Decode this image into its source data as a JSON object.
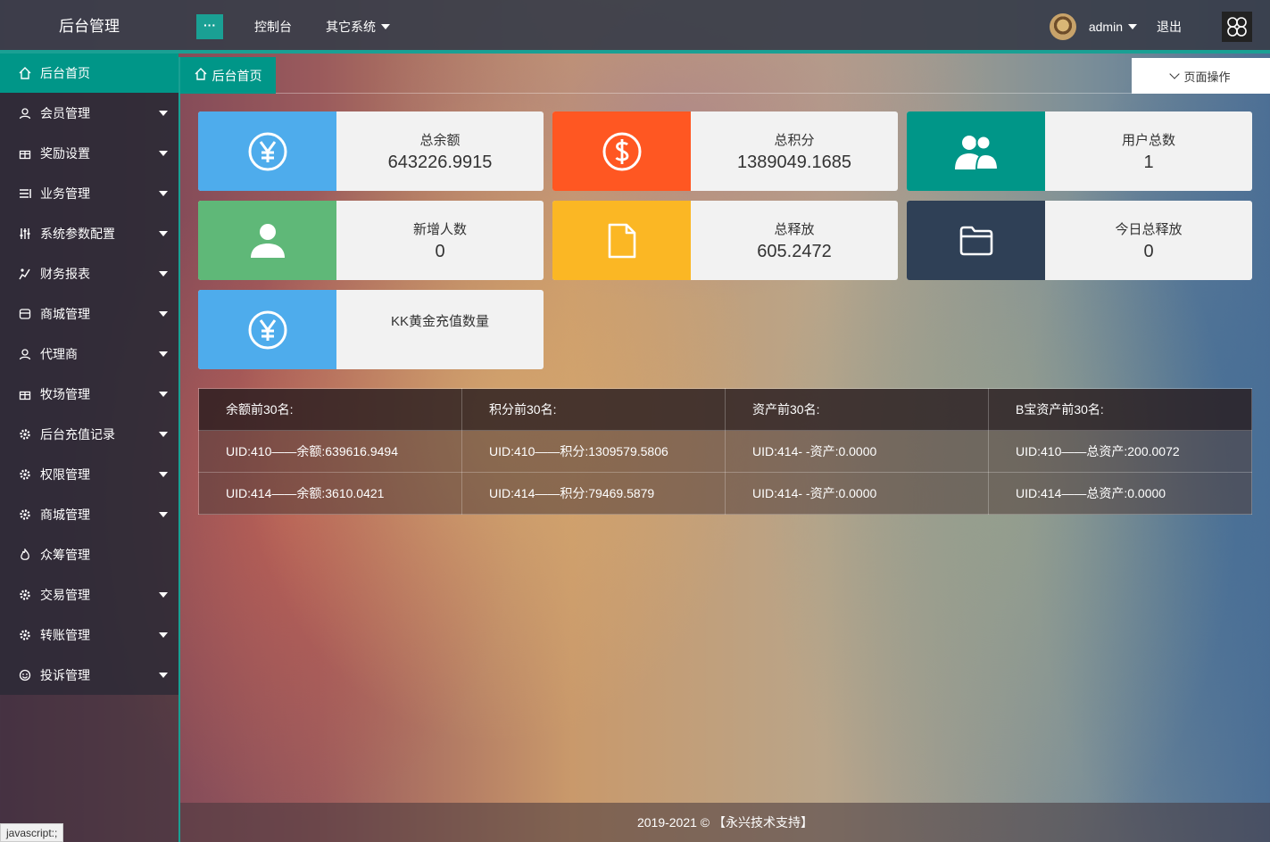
{
  "header": {
    "brand": "后台管理",
    "menu_toggle": "···",
    "nav": [
      {
        "label": "控制台"
      },
      {
        "label": "其它系统"
      }
    ],
    "username": "admin",
    "logout": "退出"
  },
  "sidebar": {
    "items": [
      {
        "label": "后台首页",
        "icon": "home-icon"
      },
      {
        "label": "会员管理",
        "icon": "user-icon"
      },
      {
        "label": "奖励设置",
        "icon": "gift-icon"
      },
      {
        "label": "业务管理",
        "icon": "list-icon"
      },
      {
        "label": "系统参数配置",
        "icon": "sliders-icon"
      },
      {
        "label": "财务报表",
        "icon": "chart-icon"
      },
      {
        "label": "商城管理",
        "icon": "store-icon"
      },
      {
        "label": "代理商",
        "icon": "user-icon"
      },
      {
        "label": "牧场管理",
        "icon": "gift-icon"
      },
      {
        "label": "后台充值记录",
        "icon": "gear-icon"
      },
      {
        "label": "权限管理",
        "icon": "gear-icon"
      },
      {
        "label": "商城管理",
        "icon": "gear-icon"
      },
      {
        "label": "众筹管理",
        "icon": "fire-icon"
      },
      {
        "label": "交易管理",
        "icon": "gear-icon"
      },
      {
        "label": "转账管理",
        "icon": "gear-icon"
      },
      {
        "label": "投诉管理",
        "icon": "smile-icon"
      }
    ]
  },
  "tabs": {
    "home": "后台首页",
    "page_ops": "页面操作"
  },
  "cards": [
    {
      "label": "总余额",
      "value": "643226.9915",
      "color": "#4eacec",
      "icon": "yen-icon"
    },
    {
      "label": "总积分",
      "value": "1389049.1685",
      "color": "#ff5722",
      "icon": "dollar-icon"
    },
    {
      "label": "用户总数",
      "value": "1",
      "color": "#009688",
      "icon": "users-icon"
    },
    {
      "label": "新增人数",
      "value": "0",
      "color": "#5fb878",
      "icon": "person-icon"
    },
    {
      "label": "总释放",
      "value": "605.2472",
      "color": "#fbb724",
      "icon": "file-icon"
    },
    {
      "label": "今日总释放",
      "value": "0",
      "color": "#2f4056",
      "icon": "folder-icon"
    },
    {
      "label": "KK黄金充值数量",
      "value": "",
      "color": "#4eacec",
      "icon": "yen-icon"
    }
  ],
  "table": {
    "headers": [
      "余额前30名:",
      "积分前30名:",
      "资产前30名:",
      "B宝资产前30名:"
    ],
    "rows": [
      [
        "UID:410——余额:639616.9494",
        "UID:410——积分:1309579.5806",
        "UID:414- -资产:0.0000",
        "UID:410——总资产:200.0072"
      ],
      [
        "UID:414——余额:3610.0421",
        "UID:414——积分:79469.5879",
        "UID:414- -资产:0.0000",
        "UID:414——总资产:0.0000"
      ]
    ]
  },
  "footer": "2019-2021 © 【永兴技术支持】",
  "statusbar": "javascript:;"
}
